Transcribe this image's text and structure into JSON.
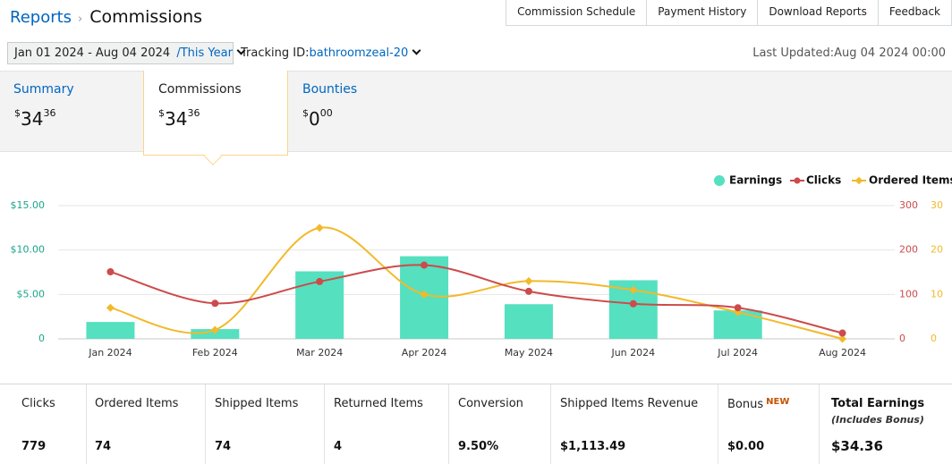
{
  "breadcrumb": {
    "parent": "Reports",
    "current": "Commissions"
  },
  "top_links": [
    "Commission Schedule",
    "Payment History",
    "Download Reports",
    "Feedback"
  ],
  "filters": {
    "date_range": "Jan 01 2024 - Aug 04 2024",
    "date_sep": "/",
    "date_preset": "This Year",
    "tracking_label": "Tracking ID:",
    "tracking_value": "bathroomzeal-20",
    "last_updated": "Last Updated:Aug 04 2024 00:00"
  },
  "tabs": {
    "summary": {
      "label": "Summary",
      "currency": "$",
      "whole": "34",
      "cents": "36"
    },
    "commissions": {
      "label": "Commissions",
      "currency": "$",
      "whole": "34",
      "cents": "36"
    },
    "bounties": {
      "label": "Bounties",
      "currency": "$",
      "whole": "0",
      "cents": "00"
    }
  },
  "colors": {
    "earnings": "#55e0c0",
    "clicks": "#cc4b4b",
    "ordered": "#f2b92a",
    "earnings_axis": "#1aa58a",
    "link": "#0066c0"
  },
  "chart_data": {
    "type": "bar",
    "categories": [
      "Jan 2024",
      "Feb 2024",
      "Mar 2024",
      "Apr 2024",
      "May 2024",
      "Jun 2024",
      "Jul 2024",
      "Aug 2024"
    ],
    "legend": [
      "Earnings",
      "Clicks",
      "Ordered Items"
    ],
    "legend_position": "top-right",
    "series": [
      {
        "name": "Earnings",
        "type": "bar",
        "axis": "left",
        "values": [
          1.9,
          1.1,
          7.6,
          9.3,
          3.9,
          6.6,
          3.2,
          0
        ]
      },
      {
        "name": "Clicks",
        "type": "line",
        "axis": "right",
        "values": [
          151,
          80,
          129,
          166,
          107,
          79,
          70,
          13
        ]
      },
      {
        "name": "Ordered Items",
        "type": "line",
        "axis": "right2",
        "values": [
          7,
          2,
          25,
          10,
          13,
          11,
          6,
          0
        ]
      }
    ],
    "y_left": {
      "ticks": [
        "0",
        "$5.00",
        "$10.00",
        "$15.00"
      ],
      "max": 15
    },
    "y_right": {
      "ticks": [
        "0",
        "100",
        "200",
        "300"
      ],
      "max": 300
    },
    "y_right2": {
      "ticks": [
        "0",
        "10",
        "20",
        "30"
      ],
      "max": 30
    },
    "grid": true
  },
  "stats": [
    {
      "label": "Clicks",
      "value": "779"
    },
    {
      "label": "Ordered Items",
      "value": "74"
    },
    {
      "label": "Shipped Items",
      "value": "74"
    },
    {
      "label": "Returned Items",
      "value": "4"
    },
    {
      "label": "Conversion",
      "value": "9.50%"
    },
    {
      "label": "Shipped Items Revenue",
      "value": "$1,113.49"
    },
    {
      "label": "Bonus",
      "badge": "NEW",
      "value": "$0.00"
    },
    {
      "label": "Total Earnings",
      "sub": "(Includes Bonus)",
      "value": "$34.36"
    }
  ]
}
